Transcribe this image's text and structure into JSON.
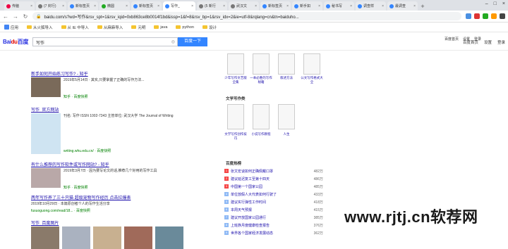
{
  "tabs": [
    {
      "label": "传脑",
      "active": false
    },
    {
      "label": "(7 封行)",
      "active": false
    },
    {
      "label": "新标签页",
      "active": false
    },
    {
      "label": "微圆",
      "active": false
    },
    {
      "label": "新标签页",
      "active": false
    },
    {
      "label": "写作_",
      "active": true
    },
    {
      "label": "(5 新行",
      "active": false
    },
    {
      "label": "武汉文",
      "active": false
    },
    {
      "label": "新标签页",
      "active": false
    },
    {
      "label": "新手如",
      "active": false
    },
    {
      "label": "秘书写",
      "active": false
    },
    {
      "label": "调查样",
      "active": false
    },
    {
      "label": "最调查",
      "active": false
    }
  ],
  "address": {
    "url": "baidu.com/s?wd=写作&rsv_spt=1&rsv_iqid=0xb863ce8b0014f1bd&issp=1&f=8&rsv_bp=1&rsv_idx=2&ie=utf-8&rqlang=cn&tn=baiduho..."
  },
  "bookmarks": [
    "应用",
    "从火狐导入",
    "从 IE 中导入",
    "从麻麻导入",
    "元明",
    "java",
    "python",
    "设计"
  ],
  "search": {
    "query": "写作",
    "button": "百度一下"
  },
  "toplinks": [
    "百度首页",
    "设置",
    "登录"
  ],
  "results": [
    {
      "title": "新手如何开始练习写作? - 知乎",
      "desc": "2019年5月14日 · 其实,只要掌握了正确的写作方法...",
      "url": "知乎 · 百度快照"
    },
    {
      "title": "写作_官方网站",
      "desc": "刊名: 写作 ISSN 1002-7343 主管单位: 武汉大学 The Journal of Writing",
      "url": "writing.whu.edu.cn/ · 百度快照"
    },
    {
      "title": "有什么推荐的写作软件或写作网站? - 知乎",
      "desc": "2019年3月7日 · 因为要写论文的话,推荐几个好用的写作工具",
      "url": "知乎 · 百度快照"
    },
    {
      "title": "两年写作养了三十只猫 超级宠物写作经历 点击拉爆表",
      "desc": "2019年10月29日 · 本篇原创者个人的写作生活分享",
      "url": "fusuoguong.com/read/18... · 百度快照"
    },
    {
      "title": "写作_百度图片",
      "desc": "",
      "url": ""
    }
  ],
  "right": {
    "books1": [
      "少年写作文艺版全集",
      "一本必胜的写作秘籍",
      "叙述方法",
      "公文写作格式大全"
    ],
    "section_books": "文学写作类",
    "books2": [
      "文学写作创作技巧",
      "小说写作教程",
      "人生"
    ],
    "section_hot": "百度热榜",
    "hot": [
      {
        "text": "张文宏谈如何正确佩戴口罩",
        "val": "482万"
      },
      {
        "text": "建议延迟复工至第十四天",
        "val": "486万"
      },
      {
        "text": "中国第一个国家公园",
        "val": "485万"
      },
      {
        "text": "单位放假人大代表如何行驶了",
        "val": "433万"
      },
      {
        "text": "建议实行弹性工作时间",
        "val": "418万"
      },
      {
        "text": "本周天气预报",
        "val": "415万"
      },
      {
        "text": "建议开放国家公园通行",
        "val": "385万"
      },
      {
        "text": "上班族月度健康检查报告",
        "val": "376万"
      },
      {
        "text": "世界各个国家经济发展动态",
        "val": "362万"
      }
    ]
  },
  "farright": [
    "百度首页",
    "设置",
    "登录"
  ],
  "watermark": "www.rjtj.cn软荐网"
}
